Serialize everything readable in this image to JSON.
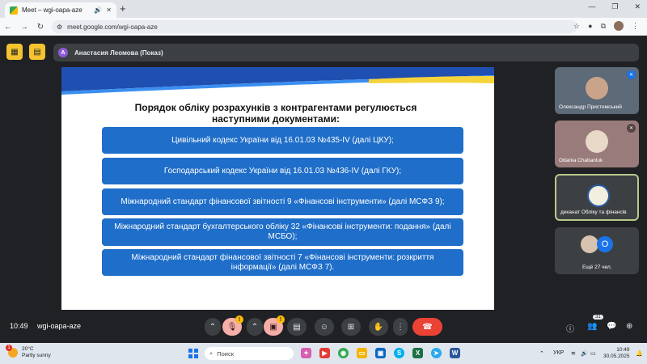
{
  "browser": {
    "tab_title": "Meet – wgi-oapa-aze",
    "url": "meet.google.com/wgi-oapa-aze"
  },
  "meet": {
    "presenter": "Анастасия Леомова (Показ)",
    "presenter_initial": "A",
    "meeting_code": "wgi-oapa-aze",
    "time": "10:49",
    "participants_count": "31"
  },
  "slide": {
    "title": "Порядок обліку розрахунків з контрагентами регулюється наступними документами:",
    "items": [
      "Цивільний кодекс України від 16.01.03 №435-IV (далі ЦКУ);",
      "Господарський кодекс України від 16.01.03 №436-IV (далі ГКУ);",
      "Міжнародний стандарт фінансової звітності 9 «Фінансові інструменти» (далі МСФЗ 9);",
      "Міжнародний стандарт бухгалтерського обліку 32 «Фінансові інструменти: подання» (далі МСБО);",
      "Міжнародний стандарт фінансової звітності 7 «Фінансові інструменти: розкриття інформації» (далі МСФЗ 7)."
    ]
  },
  "tiles": [
    {
      "name": "Олександр Пристемський"
    },
    {
      "name": "Odarka Chabanluk"
    },
    {
      "name": "деканат Обліку та фінансів"
    },
    {
      "name": "Ещё 27 чел.",
      "count": "O"
    }
  ],
  "taskbar": {
    "weather_temp": "20°C",
    "weather_desc": "Partly sunny",
    "weather_badge": "1",
    "search_placeholder": "Поиск",
    "lang": "УКР",
    "clock_time": "10:49",
    "clock_date": "30.05.2025"
  },
  "colors": {
    "accent_blue": "#1f6ec9",
    "end_call": "#ea4335",
    "warning": "#fbbc04"
  }
}
